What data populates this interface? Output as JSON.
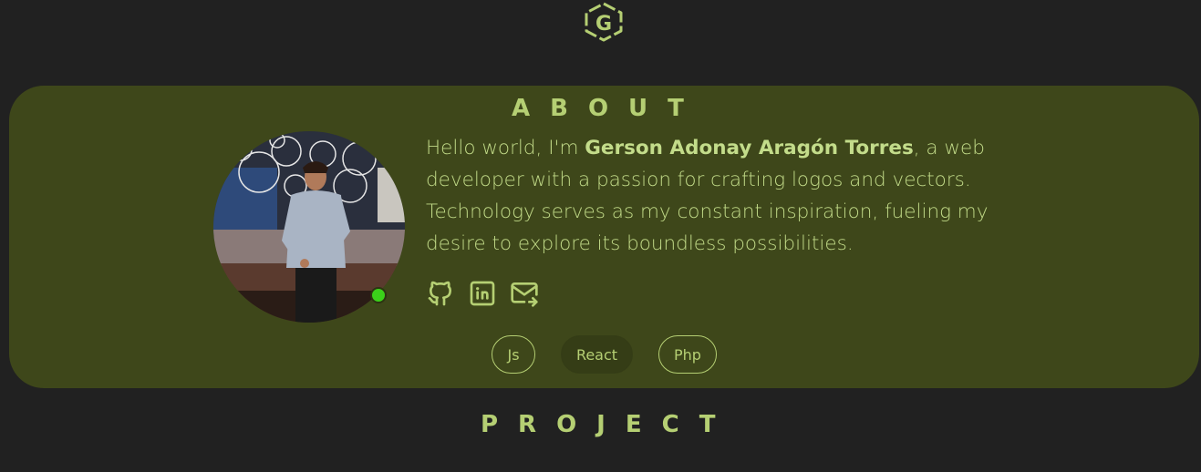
{
  "logo": {
    "icon": "g-hexagon-logo-icon",
    "color": "#b5cf73"
  },
  "about": {
    "title": "ABOUT",
    "bio_prefix": "Hello world, I'm ",
    "name": "Gerson Adonay Aragón Torres",
    "bio_suffix": ", a web developer with a passion for crafting logos and vectors. Technology serves as my constant inspiration, fueling my desire to explore its boundless possibilities.",
    "avatar": {
      "status": "online",
      "status_color": "#3bd11a"
    },
    "socials": [
      {
        "icon": "github-icon"
      },
      {
        "icon": "linkedin-icon"
      },
      {
        "icon": "mail-send-icon"
      }
    ],
    "tags": [
      {
        "label": "Js",
        "style": "outline"
      },
      {
        "label": "React",
        "style": "filled"
      },
      {
        "label": "Php",
        "style": "outline"
      }
    ]
  },
  "project": {
    "title": "PROJECT"
  },
  "colors": {
    "background": "#212121",
    "card": "#3e471a",
    "accent": "#b5cf73",
    "text": "#c0d987"
  }
}
